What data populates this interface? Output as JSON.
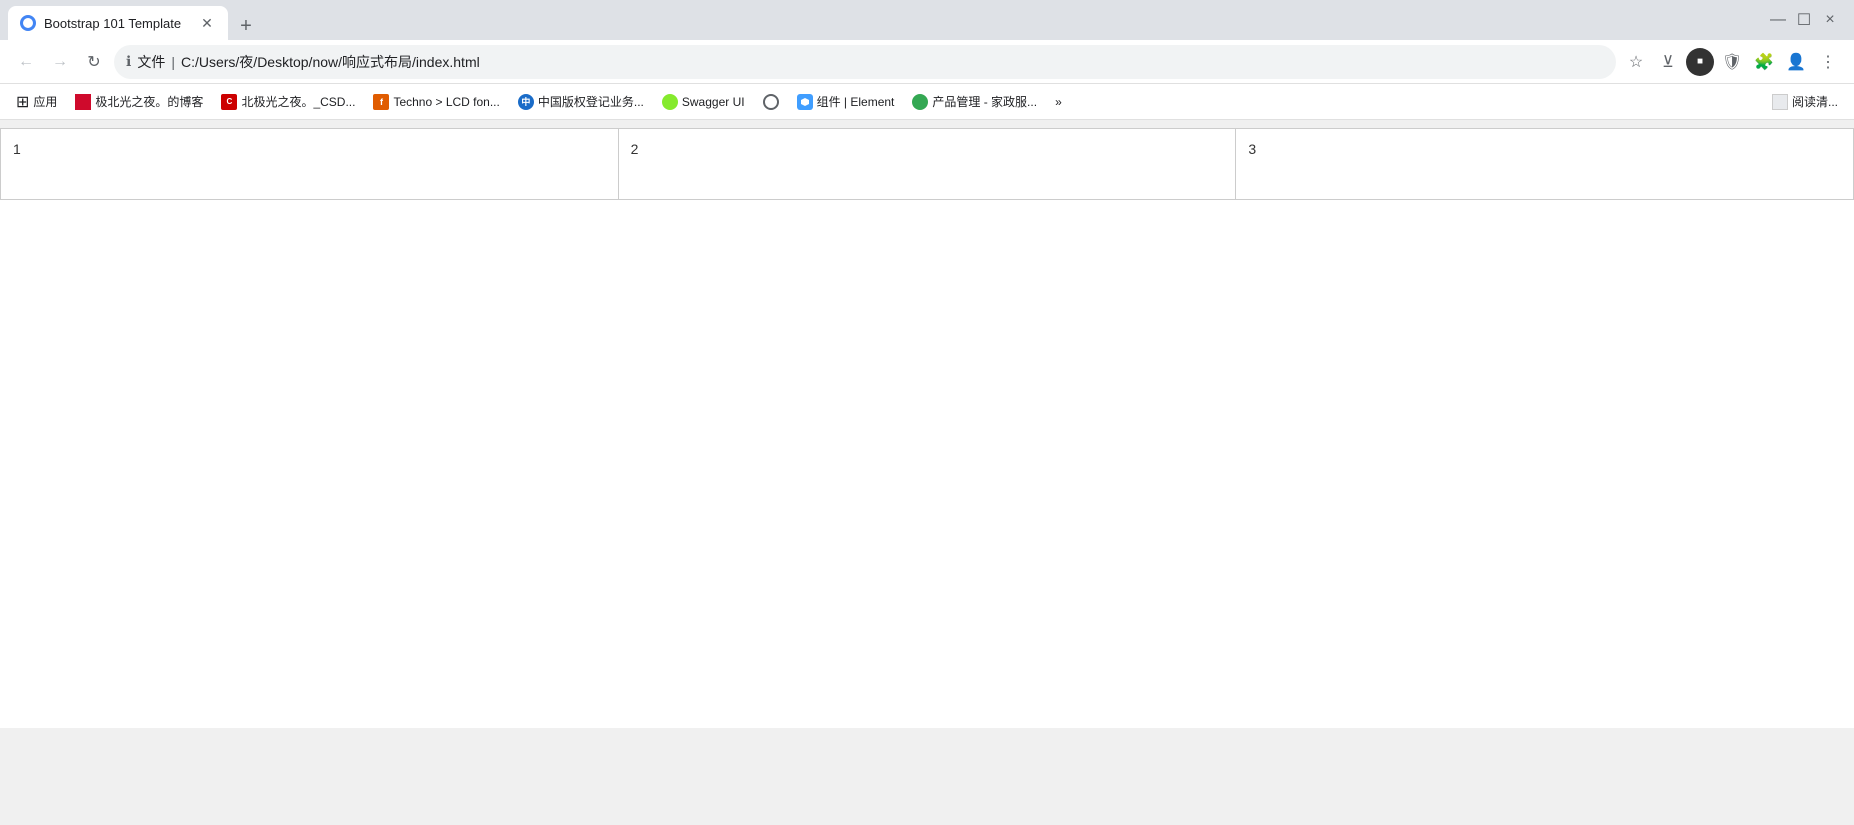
{
  "browser": {
    "tab": {
      "title": "Bootstrap 101 Template",
      "favicon": "globe-icon"
    },
    "new_tab_label": "+",
    "window_controls": {
      "minimize": "—",
      "maximize": "☐",
      "close": "×"
    },
    "address_bar": {
      "icon": "ℹ",
      "file_label": "文件",
      "separator": "|",
      "url": "C:/Users/夜/Desktop/now/响应式布局/index.html"
    },
    "nav": {
      "back": "←",
      "forward": "→",
      "refresh": "↻",
      "bookmark": "☆",
      "down_arrow": "⊻",
      "extensions": "⬛",
      "shield": "🛡",
      "puzzle": "🧩",
      "account": "👤",
      "more": "⋮"
    },
    "bookmarks": [
      {
        "id": "apps",
        "label": "应用",
        "type": "apps-icon"
      },
      {
        "id": "huawei",
        "label": "极北光之夜。的博客",
        "type": "huawei-favicon"
      },
      {
        "id": "csdn",
        "label": "北极光之夜。_CSD...",
        "type": "csdn-favicon"
      },
      {
        "id": "techno",
        "label": "Techno > LCD fon...",
        "type": "techno-favicon"
      },
      {
        "id": "china-copyright",
        "label": "中国版权登记业务...",
        "type": "china-favicon"
      },
      {
        "id": "swagger",
        "label": "Swagger UI",
        "type": "swagger-favicon"
      },
      {
        "id": "globe2",
        "label": "",
        "type": "globe-favicon"
      },
      {
        "id": "element",
        "label": "组件 | Element",
        "type": "element-favicon"
      },
      {
        "id": "product",
        "label": "产品管理 - 家政服...",
        "type": "green-favicon"
      },
      {
        "id": "more",
        "label": "»",
        "type": "more-icon"
      },
      {
        "id": "reading",
        "label": "阅读清...",
        "type": "reading-icon"
      }
    ]
  },
  "page": {
    "title": "Bootstrap 101 Template",
    "columns": [
      {
        "id": "col1",
        "label": "1"
      },
      {
        "id": "col2",
        "label": "2"
      },
      {
        "id": "col3",
        "label": "3"
      }
    ]
  }
}
